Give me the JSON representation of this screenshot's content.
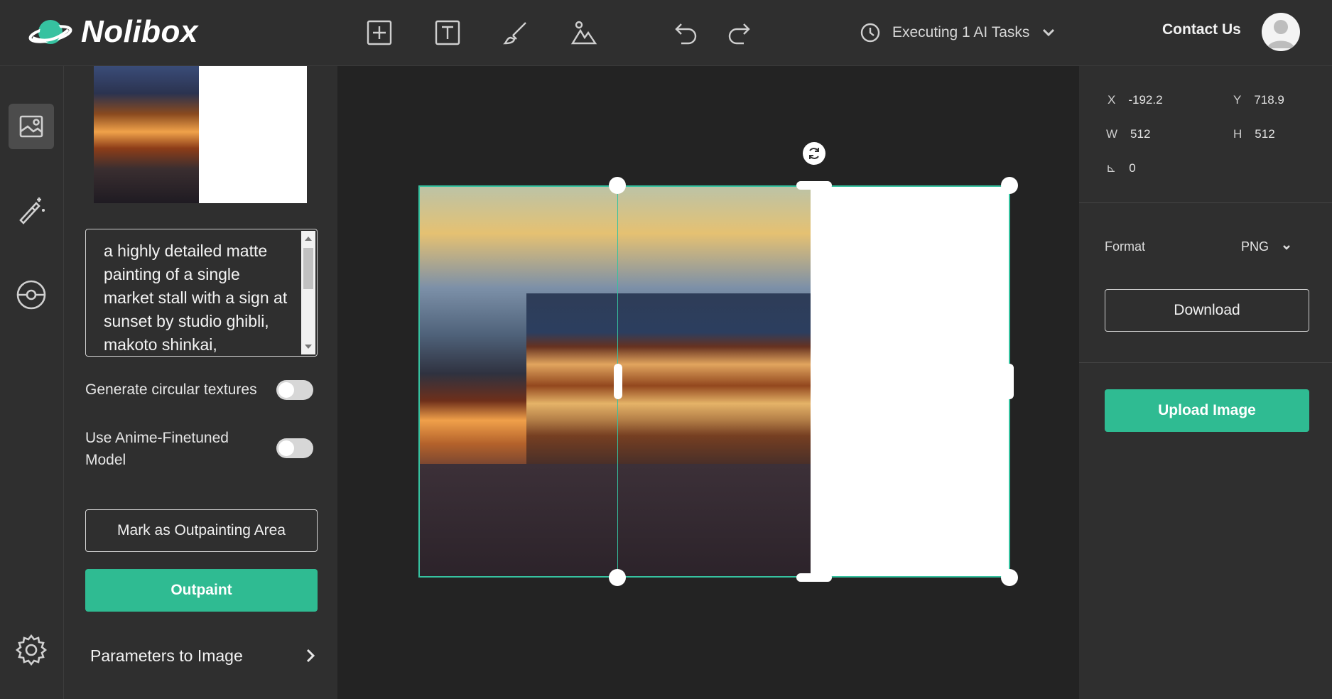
{
  "app": {
    "name": "Nolibox"
  },
  "toolbar": {
    "tools": [
      {
        "icon": "add-square-icon"
      },
      {
        "icon": "text-tool-icon"
      },
      {
        "icon": "brush-icon"
      },
      {
        "icon": "image-mountain-icon"
      },
      {
        "icon": "undo-icon"
      },
      {
        "icon": "redo-icon"
      }
    ],
    "tasks_label": "Executing 1 AI Tasks",
    "contact_label": "Contact Us"
  },
  "left_rail": {
    "items": [
      "image-gallery-icon",
      "magic-wand-icon",
      "planet-icon",
      "settings-gear-icon"
    ]
  },
  "panel": {
    "prompt": "a highly detailed matte painting of a single market stall with a sign at sunset by studio ghibli, makoto shinkai,",
    "option1_label": "Generate circular textures",
    "option2_label": "Use Anime-Finetuned Model",
    "mark_button": "Mark as Outpainting Area",
    "outpaint_button": "Outpaint",
    "params_label": "Parameters to Image"
  },
  "properties": {
    "x_label": "X",
    "x": "-192.2",
    "y_label": "Y",
    "y": "718.9",
    "w_label": "W",
    "w": "512",
    "h_label": "H",
    "h": "512",
    "angle_label": "⊾",
    "angle": "0",
    "format_label": "Format",
    "format": "PNG",
    "download_button": "Download",
    "upload_button": "Upload Image"
  },
  "colors": {
    "accent": "#2fbb92",
    "selection": "#36c2a0"
  }
}
